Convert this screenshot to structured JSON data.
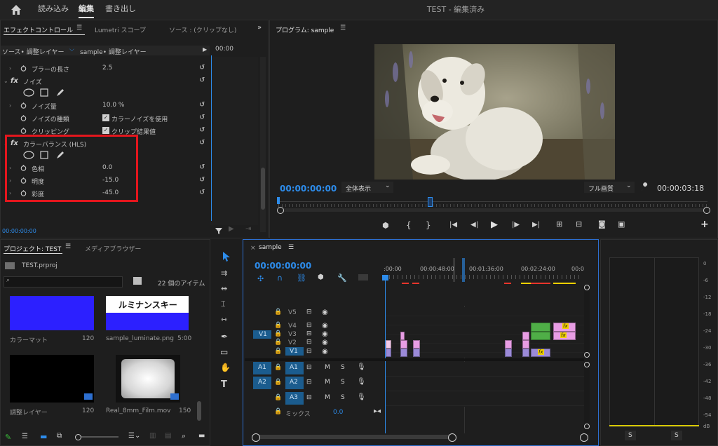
{
  "topbar": {
    "nav": [
      "読み込み",
      "編集",
      "書き出し"
    ],
    "title": "TEST - 編集済み"
  },
  "effect_panel": {
    "tabs": [
      "エフェクトコントロール",
      "Lumetri スコープ",
      "ソース : (クリップなし)"
    ],
    "source_label": "ソース• 調整レイヤー",
    "sequence_label": "sample• 調整レイヤー",
    "time_ruler": "00:00",
    "rows": {
      "blur_length": {
        "label": "ブラーの長さ",
        "value": "2.5"
      },
      "noise_header": "ノイズ",
      "noise_amount": {
        "label": "ノイズ量",
        "value": "10.0 %"
      },
      "noise_type": {
        "label": "ノイズの種類",
        "value": "カラーノイズを使用"
      },
      "clipping": {
        "label": "クリッピング",
        "value": "クリップ結果値"
      },
      "color_balance_header": "カラーバランス (HLS)",
      "hue": {
        "label": "色相",
        "value": "0.0"
      },
      "lightness": {
        "label": "明度",
        "value": "-15.0"
      },
      "saturation": {
        "label": "彩度",
        "value": "-45.0"
      }
    },
    "timecode": "00:00:00:00"
  },
  "program": {
    "title": "プログラム: sample",
    "timecode": "00:00:00:00",
    "fit": "全体表示",
    "quality": "フル画質",
    "duration": "00:00:03:18"
  },
  "project": {
    "tabs": [
      "プロジェクト: TEST",
      "メディアブラウザー"
    ],
    "file": "TEST.prproj",
    "item_count": "22 個のアイテム",
    "items": [
      {
        "name": "カラーマット",
        "dur": "120"
      },
      {
        "name": "sample_luminate.png",
        "dur": "5:00",
        "thumb_text": "ルミナンスキー"
      },
      {
        "name": "調整レイヤー",
        "dur": "120"
      },
      {
        "name": "Real_8mm_Film.mov",
        "dur": "150"
      }
    ]
  },
  "timeline": {
    "tab": "sample",
    "timecode": "00:00:00:00",
    "ruler": [
      ":00:00",
      "00:00:48:00",
      "00:01:36:00",
      "00:02:24:00",
      "00:0"
    ],
    "video_tracks": [
      "V5",
      "V4",
      "V3",
      "V2",
      "V1"
    ],
    "audio_tracks": [
      "A1",
      "A2",
      "A3"
    ],
    "src_v": "V1",
    "src_a": [
      "A1",
      "A2"
    ],
    "mix_label": "ミックス",
    "mix_value": "0.0",
    "m_label": "M",
    "s_label": "S",
    "fx_label": "fx"
  },
  "meter": {
    "ticks": [
      "0",
      "-6",
      "-12",
      "-18",
      "-24",
      "-30",
      "-36",
      "-42",
      "-48",
      "-54",
      "dB"
    ],
    "solo": [
      "S",
      "S"
    ]
  }
}
